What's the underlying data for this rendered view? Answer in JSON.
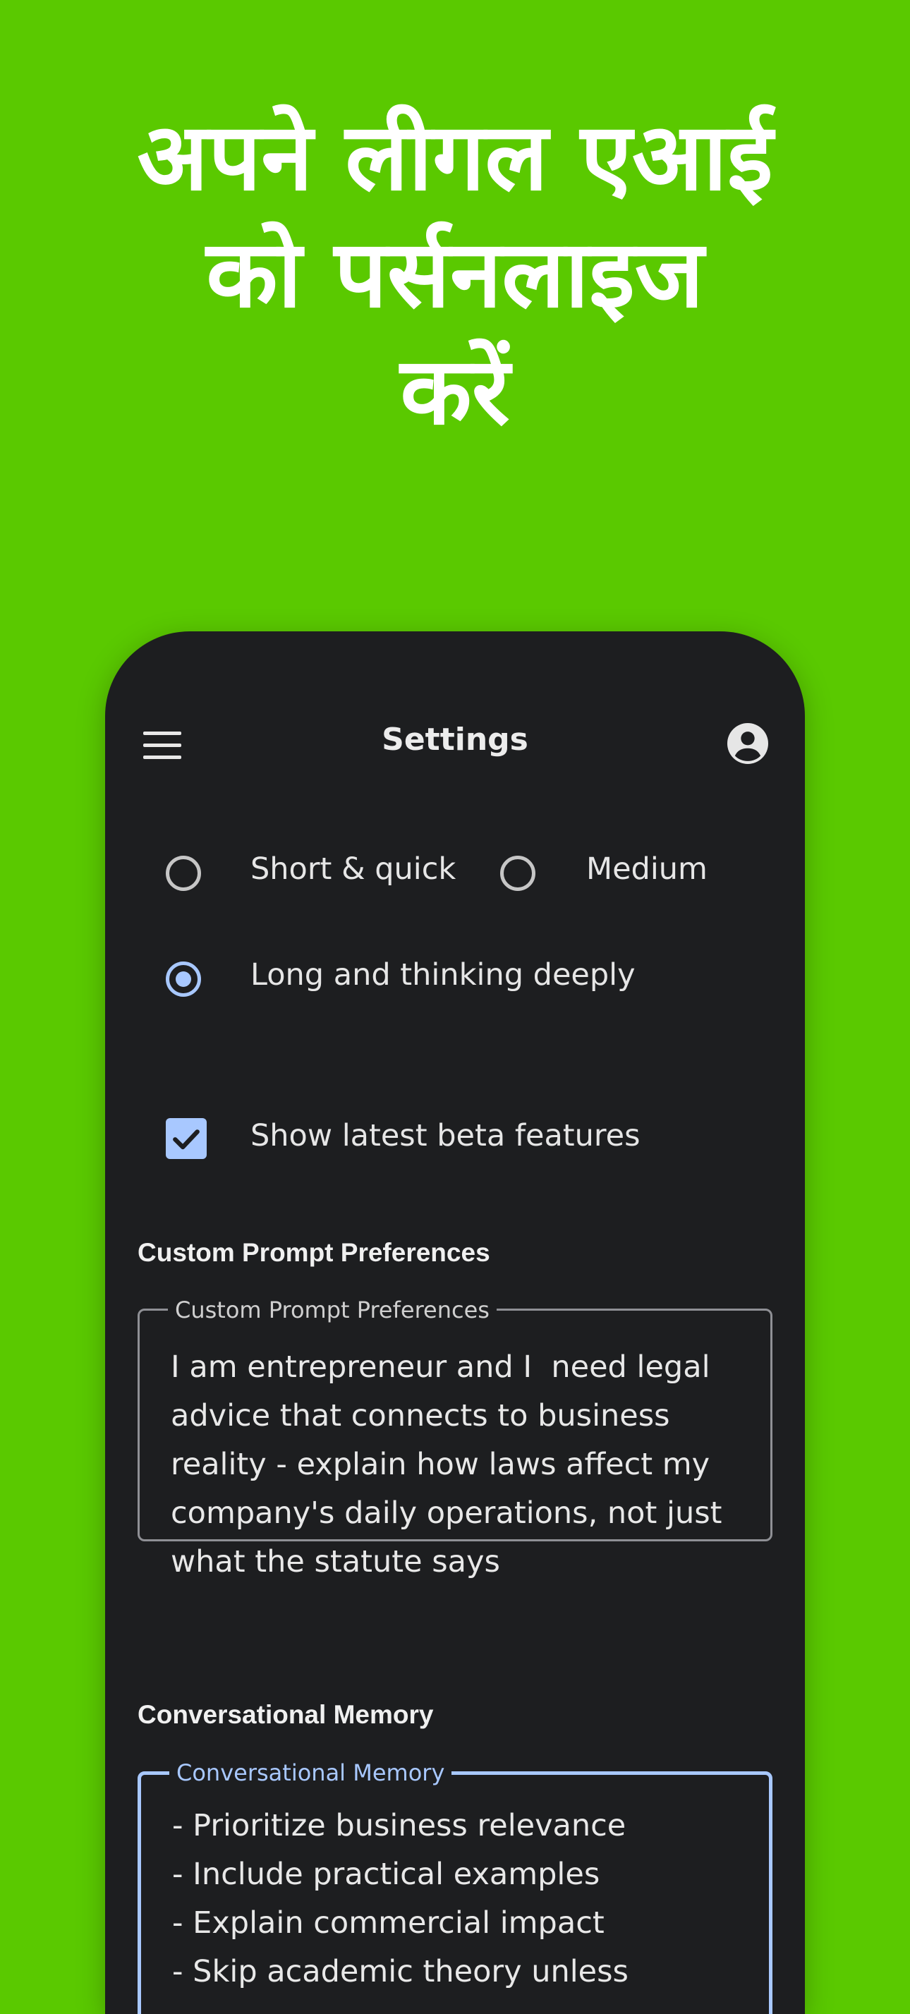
{
  "headline": {
    "line1": "अपने लीगल एआई",
    "line2": "को पर्सनलाइज",
    "line3": "करें"
  },
  "appbar": {
    "title": "Settings",
    "menu_icon": "menu-icon",
    "account_icon": "account-circle-icon"
  },
  "response_length": {
    "options": [
      {
        "label": "Short & quick",
        "selected": false
      },
      {
        "label": "Medium",
        "selected": false
      },
      {
        "label": "Long and thinking deeply",
        "selected": true
      }
    ]
  },
  "beta": {
    "label": "Show latest beta features",
    "checked": true
  },
  "custom_prompt": {
    "section_title": "Custom Prompt Preferences",
    "field_label": "Custom Prompt Preferences",
    "value": "I am entrepreneur and I  need legal advice that connects to business reality - explain how laws affect my company's daily operations, not just what the statute says"
  },
  "memory": {
    "section_title": "Conversational Memory",
    "field_label": "Conversational Memory",
    "value": "- Prioritize business relevance\n- Include practical examples\n- Explain commercial impact\n- Skip academic theory unless"
  },
  "colors": {
    "background": "#5ac900",
    "phone": "#1d1e20",
    "accent": "#a8c8ff"
  }
}
